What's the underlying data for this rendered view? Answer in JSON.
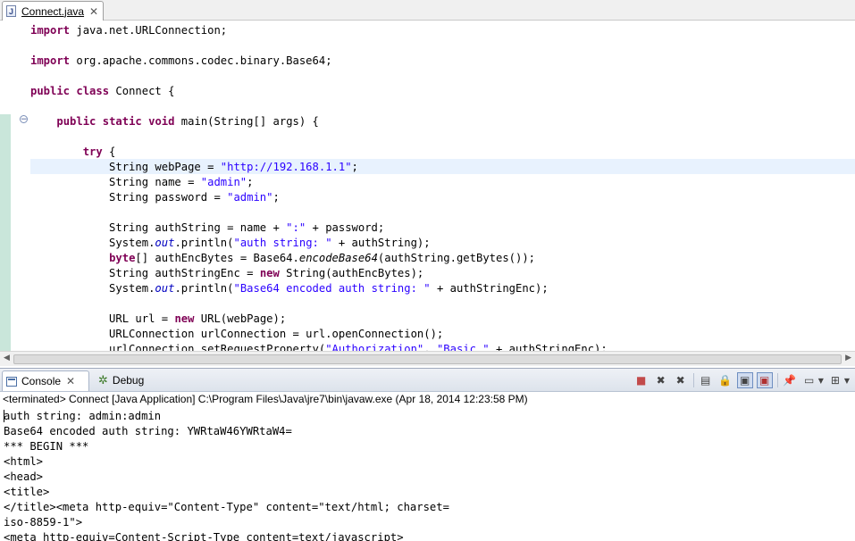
{
  "editor_tab": {
    "label": "Connect.java",
    "icon": "J"
  },
  "code_lines": [
    [
      {
        "t": "import",
        "c": "kw"
      },
      {
        "t": " java.net.URLConnection;"
      }
    ],
    [],
    [
      {
        "t": "import",
        "c": "kw"
      },
      {
        "t": " org.apache.commons.codec.binary.Base64;"
      }
    ],
    [],
    [
      {
        "t": "public",
        "c": "kw"
      },
      {
        "t": " "
      },
      {
        "t": "class",
        "c": "kw"
      },
      {
        "t": " Connect {"
      }
    ],
    [],
    [
      {
        "t": "    "
      },
      {
        "t": "public",
        "c": "kw"
      },
      {
        "t": " "
      },
      {
        "t": "static",
        "c": "kw"
      },
      {
        "t": " "
      },
      {
        "t": "void",
        "c": "kw"
      },
      {
        "t": " main(String[] args) {"
      }
    ],
    [],
    [
      {
        "t": "        "
      },
      {
        "t": "try",
        "c": "kw"
      },
      {
        "t": " {"
      }
    ],
    [
      {
        "t": "            String webPage = "
      },
      {
        "t": "\"http://192.168.1.1\"",
        "c": "str"
      },
      {
        "t": ";"
      }
    ],
    [
      {
        "t": "            String name = "
      },
      {
        "t": "\"admin\"",
        "c": "str"
      },
      {
        "t": ";"
      }
    ],
    [
      {
        "t": "            String password = "
      },
      {
        "t": "\"admin\"",
        "c": "str"
      },
      {
        "t": ";"
      }
    ],
    [],
    [
      {
        "t": "            String authString = name + "
      },
      {
        "t": "\":\"",
        "c": "str"
      },
      {
        "t": " + password;"
      }
    ],
    [
      {
        "t": "            System."
      },
      {
        "t": "out",
        "c": "fld"
      },
      {
        "t": ".println("
      },
      {
        "t": "\"auth string: \"",
        "c": "str"
      },
      {
        "t": " + authString);"
      }
    ],
    [
      {
        "t": "            "
      },
      {
        "t": "byte",
        "c": "kw"
      },
      {
        "t": "[] authEncBytes = Base64."
      },
      {
        "t": "encodeBase64",
        "c": "mth"
      },
      {
        "t": "(authString.getBytes());"
      }
    ],
    [
      {
        "t": "            String authStringEnc = "
      },
      {
        "t": "new",
        "c": "kw"
      },
      {
        "t": " String(authEncBytes);"
      }
    ],
    [
      {
        "t": "            System."
      },
      {
        "t": "out",
        "c": "fld"
      },
      {
        "t": ".println("
      },
      {
        "t": "\"Base64 encoded auth string: \"",
        "c": "str"
      },
      {
        "t": " + authStringEnc);"
      }
    ],
    [],
    [
      {
        "t": "            URL url = "
      },
      {
        "t": "new",
        "c": "kw"
      },
      {
        "t": " URL(webPage);"
      }
    ],
    [
      {
        "t": "            URLConnection urlConnection = url.openConnection();"
      }
    ],
    [
      {
        "t": "            urlConnection.setRequestProperty("
      },
      {
        "t": "\"Authorization\"",
        "c": "str"
      },
      {
        "t": ", "
      },
      {
        "t": "\"Basic \"",
        "c": "str"
      },
      {
        "t": " + authStringEnc);"
      }
    ]
  ],
  "console": {
    "tab_label": "Console",
    "debug_label": "Debug",
    "terminated": "<terminated> Connect [Java Application] C:\\Program Files\\Java\\jre7\\bin\\javaw.exe (Apr 18, 2014 12:23:58 PM)",
    "output": [
      "auth string: admin:admin",
      "Base64 encoded auth string: YWRtaW46YWRtaW4=",
      "*** BEGIN ***",
      "<html>",
      "<head>",
      "<title>",
      "</title><meta http-equiv=\"Content-Type\" content=\"text/html; charset=",
      "iso-8859-1\">",
      "<meta http-equiv=Content-Script-Type content=text/javascript>"
    ]
  },
  "icons": {
    "tab_close": "close-icon",
    "toolbar": [
      "terminate-icon",
      "remove-launch-icon",
      "remove-all-terminated-icon",
      "clear-console-icon",
      "scroll-lock-icon",
      "show-on-stdout-icon",
      "show-on-stderr-icon",
      "pin-console-icon",
      "display-selected-console-icon",
      "open-console-icon"
    ]
  },
  "colors": {
    "keyword": "#7f0055",
    "string": "#2a00ff",
    "field": "#0000c0",
    "current_line": "#e8f2fe",
    "change_bar": "#c9e6da"
  }
}
